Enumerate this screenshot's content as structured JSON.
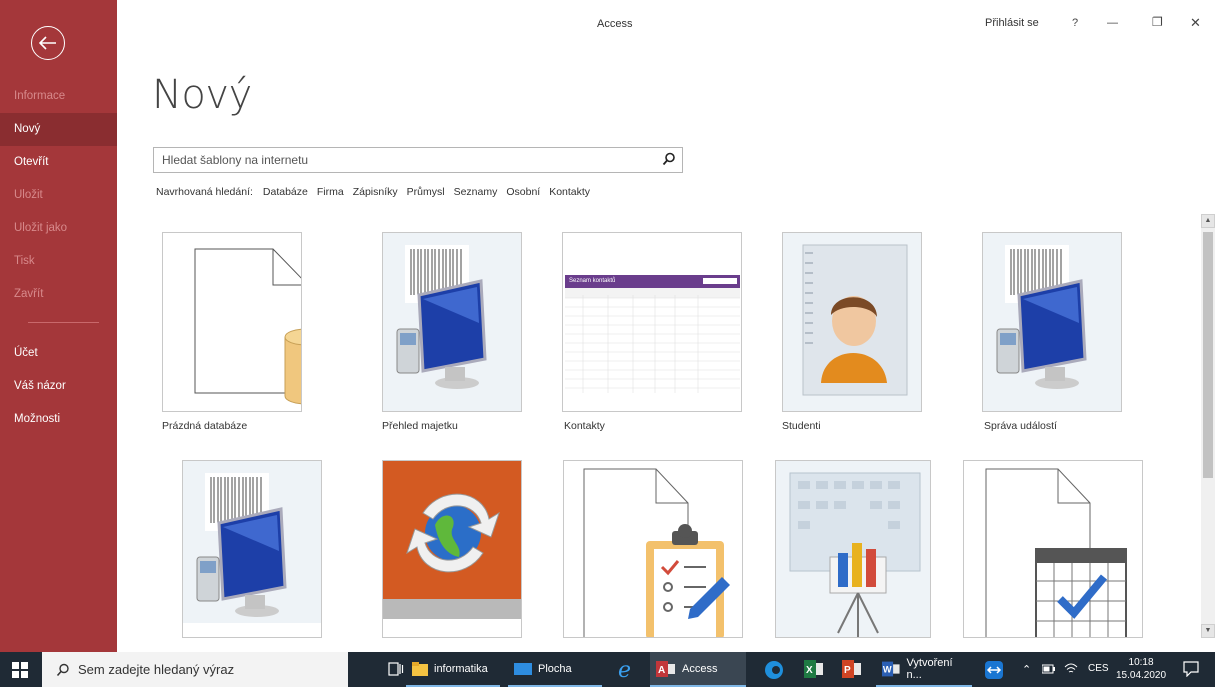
{
  "window": {
    "app_title": "Access",
    "signin_label": "Přihlásit se",
    "help_label": "?",
    "min_label": "—",
    "restore_label": "❐",
    "close_label": "✕"
  },
  "sidebar": {
    "items": [
      {
        "label": "Informace",
        "state": "disabled"
      },
      {
        "label": "Nový",
        "state": "active"
      },
      {
        "label": "Otevřít",
        "state": "normal"
      },
      {
        "label": "Uložit",
        "state": "disabled"
      },
      {
        "label": "Uložit jako",
        "state": "disabled"
      },
      {
        "label": "Tisk",
        "state": "disabled"
      },
      {
        "label": "Zavřít",
        "state": "disabled"
      }
    ],
    "bottom_items": [
      {
        "label": "Účet"
      },
      {
        "label": "Váš názor"
      },
      {
        "label": "Možnosti"
      }
    ]
  },
  "main": {
    "title": "Nový",
    "search_placeholder": "Hledat šablony na internetu",
    "suggested_label": "Navrhovaná hledání:",
    "suggested": [
      "Databáze",
      "Firma",
      "Zápisníky",
      "Průmysl",
      "Seznamy",
      "Osobní",
      "Kontakty"
    ],
    "templates": [
      {
        "label": "Prázdná databáze"
      },
      {
        "label": "Přehled majetku"
      },
      {
        "label": "Kontakty",
        "preview_title": "Seznam kontaktů"
      },
      {
        "label": "Studenti"
      },
      {
        "label": "Správa událostí"
      }
    ]
  },
  "taskbar": {
    "search_placeholder": "Sem zadejte hledaný výraz",
    "items": [
      {
        "label": "informatika"
      },
      {
        "label": "Plocha"
      },
      {
        "label": "Access"
      },
      {
        "label": "Vytvoření n..."
      }
    ],
    "lang": "CES",
    "time": "10:18",
    "date": "15.04.2020"
  },
  "colors": {
    "sidebar": "#a4373a",
    "sidebar_active": "#8a2d30",
    "taskbar": "#1f2a35"
  }
}
